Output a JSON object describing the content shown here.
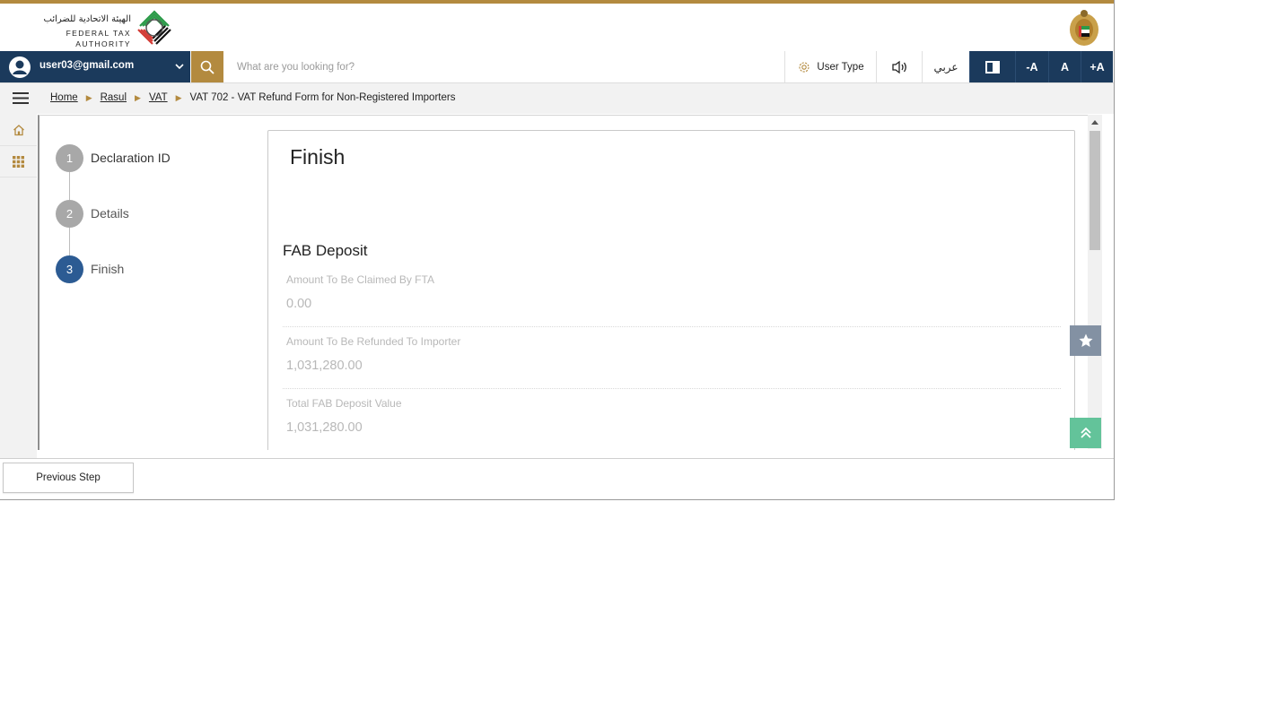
{
  "header": {
    "logo_arabic": "الهيئة الاتحادية للضرائب",
    "logo_english": "FEDERAL TAX AUTHORITY",
    "logo_icon": "fta-logo-icon",
    "emblem_icon": "uae-emblem-icon"
  },
  "navbar": {
    "user_email": "user03@gmail.com",
    "search_placeholder": "What are you looking for?",
    "user_type_label": "User Type",
    "language_label": "عربي",
    "font_decrease": "-A",
    "font_reset": "A",
    "font_increase": "+A"
  },
  "breadcrumb": {
    "items": [
      "Home",
      "Rasul",
      "VAT"
    ],
    "current": "VAT 702 - VAT Refund Form for Non-Registered Importers"
  },
  "steps": [
    {
      "number": "1",
      "label": "Declaration ID",
      "state": "done"
    },
    {
      "number": "2",
      "label": "Details",
      "state": "done"
    },
    {
      "number": "3",
      "label": "Finish",
      "state": "active"
    }
  ],
  "panel": {
    "title": "Finish",
    "section_title": "FAB Deposit",
    "fields": [
      {
        "label": "Amount To Be Claimed By FTA",
        "value": "0.00"
      },
      {
        "label": "Amount To Be Refunded To Importer",
        "value": "1,031,280.00"
      },
      {
        "label": "Total FAB Deposit Value",
        "value": "1,031,280.00"
      }
    ]
  },
  "footer": {
    "previous_label": "Previous Step"
  },
  "colors": {
    "gold": "#b38a3f",
    "navy": "#1b3a5c",
    "step_active": "#2c5b93",
    "step_done": "#a8a8a8",
    "scroll_top_green": "#63c39a"
  }
}
